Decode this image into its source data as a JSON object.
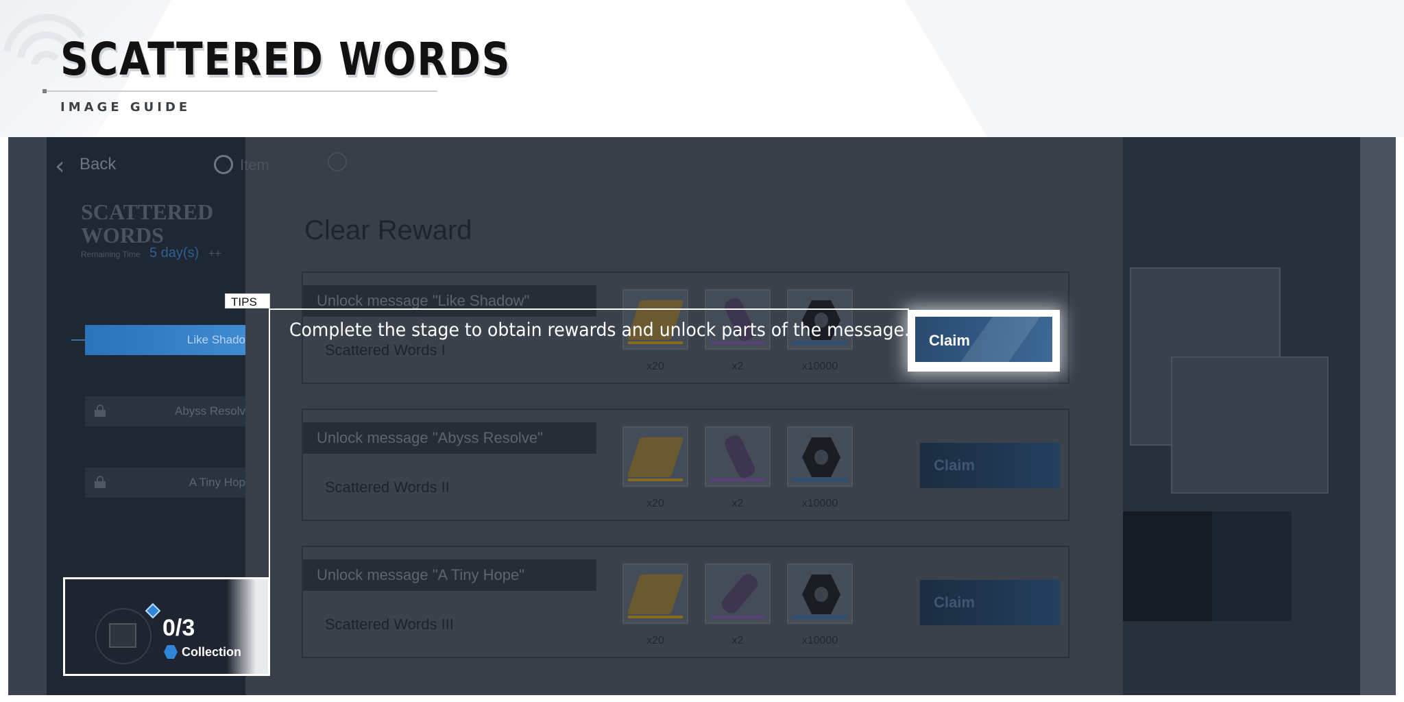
{
  "guide": {
    "title": "SCATTERED WORDS",
    "subtitle": "IMAGE GUIDE"
  },
  "topbar": {
    "back_label": "Back",
    "item_label": "Item"
  },
  "sidebar": {
    "title_line1": "SCATTERED",
    "title_line2": "WORDS",
    "remaining_label": "Remaining Time",
    "remaining_value": "5 day(s)",
    "plus": "++",
    "items": [
      {
        "label": "Like Shado",
        "locked": false,
        "active": true
      },
      {
        "label": "Abyss Resolv",
        "locked": true,
        "active": false
      },
      {
        "label": "A Tiny Hop",
        "locked": true,
        "active": false
      }
    ]
  },
  "panel": {
    "title": "Clear Reward",
    "cards": [
      {
        "message": "Unlock message \"Like Shadow\"",
        "stage": "Scattered Words I",
        "quantities": [
          "x20",
          "x2",
          "x10000"
        ],
        "claim_label": "Claim"
      },
      {
        "message": "Unlock message \"Abyss Resolve\"",
        "stage": "Scattered Words II",
        "quantities": [
          "x20",
          "x2",
          "x10000"
        ],
        "claim_label": "Claim"
      },
      {
        "message": "Unlock message \"A Tiny Hope\"",
        "stage": "Scattered Words III",
        "quantities": [
          "x20",
          "x2",
          "x10000"
        ],
        "claim_label": "Claim"
      }
    ]
  },
  "tips": {
    "tag": "TIPS",
    "text": "Complete the stage to obtain rewards and unlock parts of the message.",
    "highlight_button_label": "Claim"
  },
  "collection": {
    "count": "0/3",
    "label": "Collection"
  },
  "icons": {
    "back": "chevron-left-icon",
    "item": "ring-icon",
    "info": "info-icon",
    "lock": "lock-icon",
    "reward_1": "ticket-icon",
    "reward_2": "capsule-icon",
    "reward_3": "hexnut-icon",
    "collection_box": "box-icon",
    "collection_diamond": "diamond-icon",
    "collection_hex": "hexagon-icon"
  },
  "colors": {
    "accent_blue": "#2f86d8",
    "claim_blue": "#325a86",
    "sidebar_active": "#3f8ad0"
  }
}
